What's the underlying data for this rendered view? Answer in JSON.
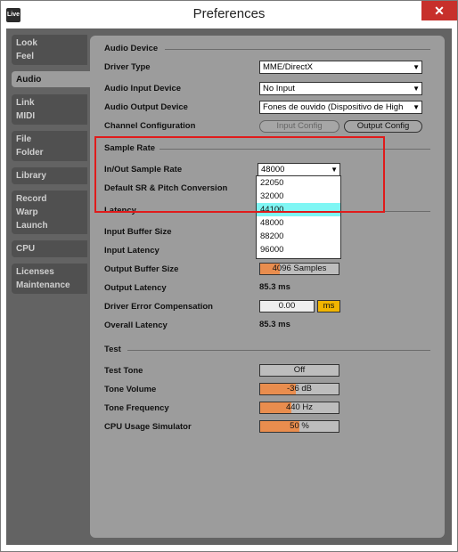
{
  "window": {
    "title": "Preferences",
    "app_icon": "Live",
    "close_glyph": "✕"
  },
  "tabs": [
    {
      "lines": [
        "Look",
        "Feel"
      ],
      "active": false
    },
    {
      "lines": [
        "Audio"
      ],
      "active": true
    },
    {
      "lines": [
        "Link",
        "MIDI"
      ],
      "active": false
    },
    {
      "lines": [
        "File",
        "Folder"
      ],
      "active": false
    },
    {
      "lines": [
        "Library"
      ],
      "active": false
    },
    {
      "lines": [
        "Record",
        "Warp",
        "Launch"
      ],
      "active": false
    },
    {
      "lines": [
        "CPU"
      ],
      "active": false
    },
    {
      "lines": [
        "Licenses",
        "Maintenance"
      ],
      "active": false
    }
  ],
  "audio_device": {
    "section": "Audio Device",
    "driver_type_label": "Driver Type",
    "driver_type_value": "MME/DirectX",
    "input_device_label": "Audio Input Device",
    "input_device_value": "No Input",
    "output_device_label": "Audio Output Device",
    "output_device_value": "Fones de ouvido (Dispositivo de High",
    "channel_config_label": "Channel Configuration",
    "input_config_button": "Input Config",
    "output_config_button": "Output Config"
  },
  "sample_rate": {
    "section": "Sample Rate",
    "inout_label": "In/Out Sample Rate",
    "inout_value": "48000",
    "default_sr_label": "Default SR & Pitch Conversion",
    "options": [
      "22050",
      "32000",
      "44100",
      "48000",
      "88200",
      "96000"
    ],
    "highlighted_option": "44100"
  },
  "latency": {
    "section": "Latency",
    "input_buffer_label": "Input Buffer Size",
    "input_latency_label": "Input Latency",
    "output_buffer_label": "Output Buffer Size",
    "output_buffer_value": "4096 Samples",
    "output_buffer_fill": 0.25,
    "output_latency_label": "Output Latency",
    "output_latency_value": "85.3 ms",
    "driver_comp_label": "Driver Error Compensation",
    "driver_comp_value": "0.00",
    "driver_comp_unit": "ms",
    "overall_latency_label": "Overall Latency",
    "overall_latency_value": "85.3 ms"
  },
  "test": {
    "section": "Test",
    "tone_label": "Test Tone",
    "tone_value": "Off",
    "volume_label": "Tone Volume",
    "volume_value": "-36 dB",
    "volume_fill": 0.45,
    "frequency_label": "Tone Frequency",
    "frequency_value": "440 Hz",
    "frequency_fill": 0.4,
    "cpu_label": "CPU Usage Simulator",
    "cpu_value": "50 %",
    "cpu_fill": 0.5
  },
  "colors": {
    "accent_fill": "#e98d4e",
    "highlight_annotation": "#e01b1b",
    "dropdown_highlight": "#7ff6f4",
    "close_button": "#c7302b"
  }
}
